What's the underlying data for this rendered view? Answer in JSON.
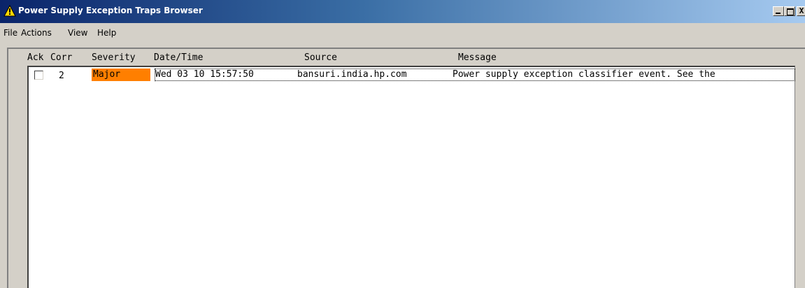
{
  "window": {
    "title": "Power Supply Exception Traps Browser",
    "title_icon": "warning-icon",
    "caption_buttons": {
      "minimize": "minimize",
      "maximize": "maximize",
      "close": "X"
    }
  },
  "menubar": {
    "items": [
      {
        "label": "File"
      },
      {
        "label": "Actions"
      },
      {
        "label": "View"
      },
      {
        "label": "Help"
      }
    ]
  },
  "table": {
    "columns": [
      "Ack",
      "Corr",
      "Severity",
      "Date/Time",
      "Source",
      "Message"
    ],
    "rows": [
      {
        "ack": false,
        "corr": "2",
        "severity": "Major",
        "severity_color": "#ff7f00",
        "datetime": "Wed 03 10 15:57:50",
        "source": "bansuri.india.hp.com",
        "message": "Power supply exception classifier event. See the"
      }
    ]
  },
  "colors": {
    "title_gradient_start": "#0a246a",
    "title_gradient_end": "#a6caf0",
    "window_background": "#d4d0c8",
    "list_background": "#ffffff",
    "major_severity": "#ff7f00"
  }
}
